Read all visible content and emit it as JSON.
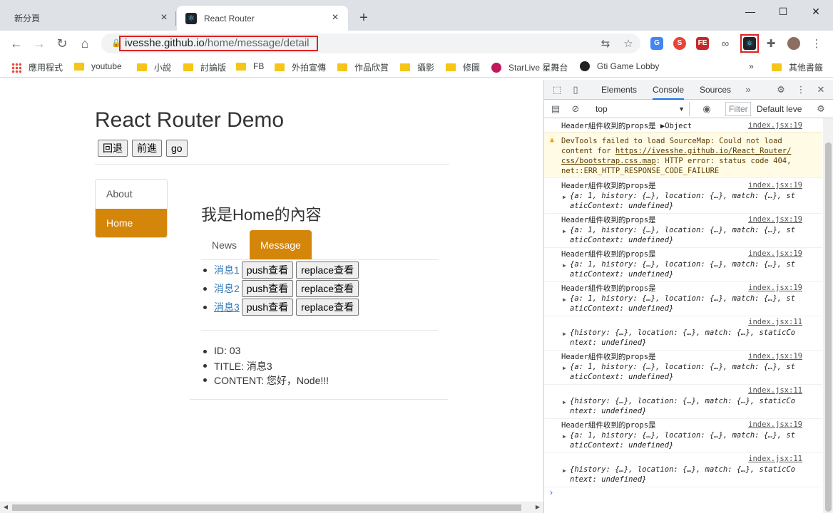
{
  "browser": {
    "tabs": [
      {
        "title": "新分頁"
      },
      {
        "title": "React Router"
      }
    ],
    "new_tab_label": "+",
    "window_controls": {
      "minimize": "—",
      "maximize": "☐",
      "close": "✕"
    },
    "url_host": "ivesshe.github.io",
    "url_path": "/home/message/detail",
    "bookmarks": [
      {
        "label": "應用程式",
        "icon": "apps-grid-icon"
      },
      {
        "label": "youtube",
        "icon": "folder-icon"
      },
      {
        "label": "小說",
        "icon": "folder-icon"
      },
      {
        "label": "討論版",
        "icon": "folder-icon"
      },
      {
        "label": "FB",
        "icon": "folder-icon"
      },
      {
        "label": "外拍宣傳",
        "icon": "folder-icon"
      },
      {
        "label": "作品欣賞",
        "icon": "folder-icon"
      },
      {
        "label": "攝影",
        "icon": "folder-icon"
      },
      {
        "label": "修圖",
        "icon": "folder-icon"
      },
      {
        "label": "StarLive 星舞台",
        "icon": "starlive-icon"
      },
      {
        "label": "Gti Game Lobby",
        "icon": "gti-icon"
      },
      {
        "label": "其他書籤",
        "icon": "folder-icon"
      }
    ],
    "bookmarks_overflow": "»"
  },
  "app": {
    "title": "React Router Demo",
    "history_buttons": {
      "back": "回退",
      "forward": "前進",
      "go": "go"
    },
    "sidenav": [
      {
        "label": "About",
        "active": false
      },
      {
        "label": "Home",
        "active": true
      }
    ],
    "home_heading": "我是Home的內容",
    "home_tabs": [
      {
        "label": "News",
        "active": false
      },
      {
        "label": "Message",
        "active": true
      }
    ],
    "messages": [
      {
        "title": "消息1",
        "push": "push查看",
        "replace": "replace查看"
      },
      {
        "title": "消息2",
        "push": "push查看",
        "replace": "replace查看"
      },
      {
        "title": "消息3",
        "push": "push查看",
        "replace": "replace查看"
      }
    ],
    "detail": {
      "id": "ID: 03",
      "title": "TITLE: 消息3",
      "content": "CONTENT: 您好，Node!!!"
    }
  },
  "devtools": {
    "tabs": [
      "Elements",
      "Console",
      "Sources"
    ],
    "active_tab": "Console",
    "context": "top",
    "filter_placeholder": "Filter",
    "levels": "Default leve",
    "console": {
      "m1_text": "Header組件收到的props是",
      "m1_value": "Object",
      "m1_src": "index.jsx:19",
      "warn_l1": "DevTools failed to load SourceMap: Could not load",
      "warn_l2": "content for",
      "warn_link1": "https://ivesshe.github.io/React_Router/",
      "warn_link2": "css/bootstrap.css.map",
      "warn_l3": ": HTTP error: status code 404,",
      "warn_l4": "net::ERR_HTTP_RESPONSE_CODE_FAILURE",
      "props_text": "Header組件收到的props是",
      "props_src": "index.jsx:19",
      "props_obj_l1": "{a: 1, history: {…}, location: {…}, match: {…}, st",
      "props_obj_l2": "aticContext: undefined}",
      "route_src": "index.jsx:11",
      "route_obj_l1": "{history: {…}, location: {…}, match: {…}, staticCo",
      "route_obj_l2": "ntext: undefined}",
      "prompt": "›"
    }
  }
}
